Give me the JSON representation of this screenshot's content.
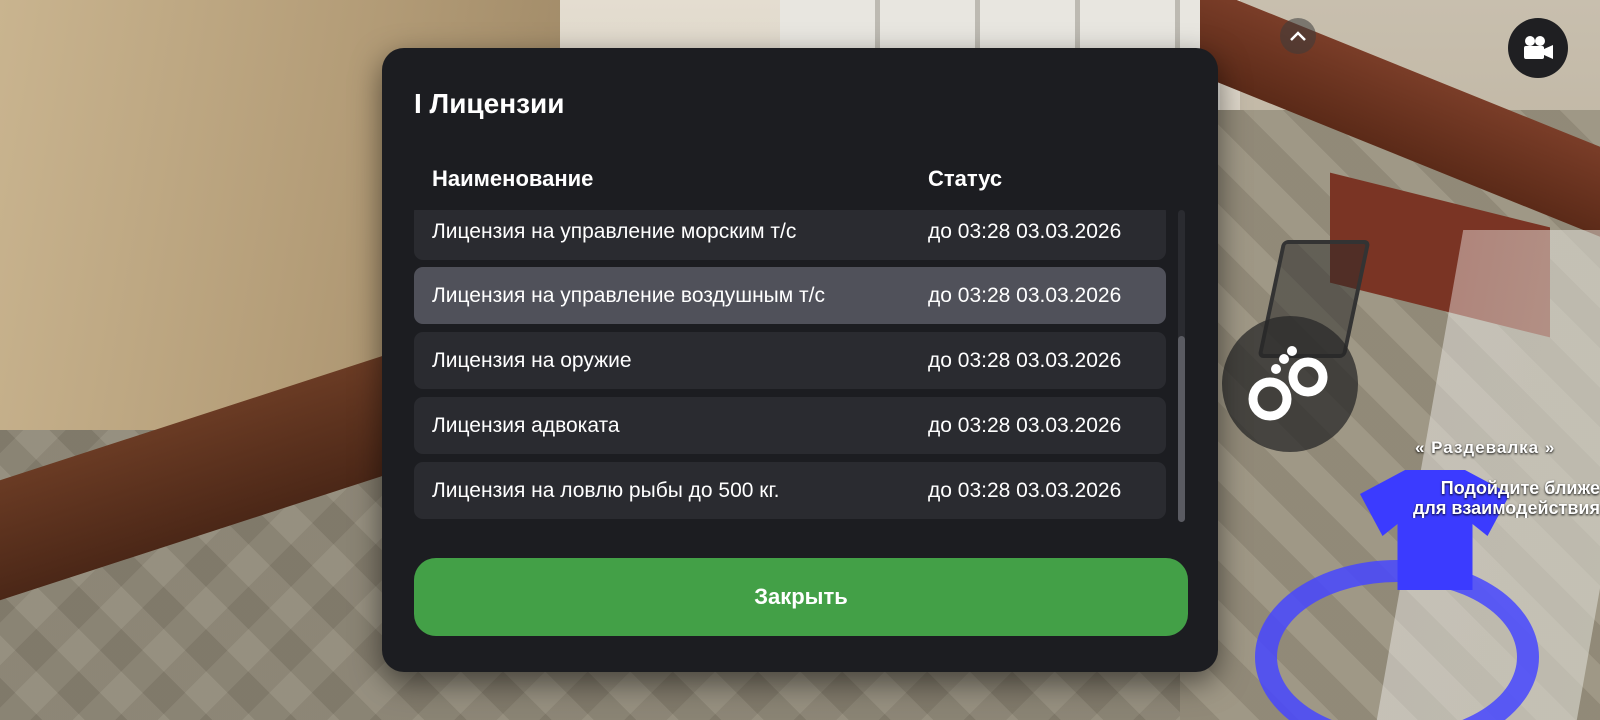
{
  "modal": {
    "title": "I Лицензии",
    "columns": {
      "name": "Наименование",
      "status": "Статус"
    },
    "rows": [
      {
        "name": "Лицензия на управление морским т/с",
        "status": "до 03:28 03.03.2026",
        "selected": false
      },
      {
        "name": "Лицензия на управление воздушным т/с",
        "status": "до 03:28 03.03.2026",
        "selected": true
      },
      {
        "name": "Лицензия на оружие",
        "status": "до 03:28 03.03.2026",
        "selected": false
      },
      {
        "name": "Лицензия адвоката",
        "status": "до 03:28 03.03.2026",
        "selected": false
      },
      {
        "name": "Лицензия на ловлю рыбы до 500 кг.",
        "status": "до 03:28 03.03.2026",
        "selected": false
      }
    ],
    "close_label": "Закрыть"
  },
  "hud": {
    "chevron_icon": "chevron-up-icon",
    "camera_icon": "video-camera-icon",
    "action_icon": "handcuffs-icon"
  },
  "world": {
    "zone_title": "« Раздевалка »",
    "zone_hint": "Подойдите ближе\nдля взаимодействия"
  },
  "colors": {
    "modal_bg": "#1c1d21",
    "row_bg": "#2a2b30",
    "row_selected_bg": "#50515a",
    "close_button": "#43a047",
    "marker": "#3b3bff"
  }
}
